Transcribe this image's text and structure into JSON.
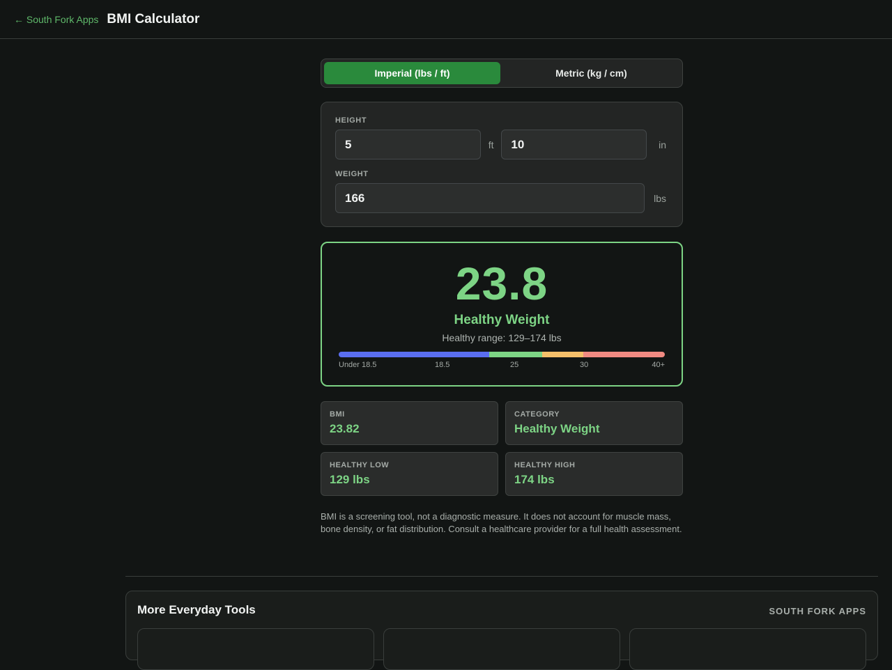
{
  "header": {
    "back_label": "← South Fork Apps",
    "title": "BMI Calculator"
  },
  "unit_toggle": {
    "options": [
      "Imperial (lbs / ft)",
      "Metric (kg / cm)"
    ],
    "selected": "Imperial (lbs / ft)"
  },
  "inputs": {
    "height_label": "HEIGHT",
    "height_ft": "5",
    "ft_unit": "ft",
    "height_in": "10",
    "in_unit": "in",
    "weight_label": "WEIGHT",
    "weight": "166",
    "weight_unit": "lbs"
  },
  "result": {
    "bmi": "23.8",
    "category": "Healthy Weight",
    "healthy_range": "Healthy range: 129–174 lbs",
    "marker_color": "#7dd485",
    "scale": {
      "segments": [
        {
          "color": "#5a6ef0",
          "from": 0,
          "to": 18.5
        },
        {
          "color": "#7dd485",
          "from": 18.5,
          "to": 25
        },
        {
          "color": "#f5c06a",
          "from": 25,
          "to": 30
        },
        {
          "color": "#f08a82",
          "from": 30,
          "to": 40
        }
      ],
      "labels": [
        "Under 18.5",
        "18.5",
        "25",
        "30",
        "40+"
      ]
    }
  },
  "stats": [
    {
      "label": "BMI",
      "value": "23.82"
    },
    {
      "label": "CATEGORY",
      "value": "Healthy Weight"
    },
    {
      "label": "HEALTHY LOW",
      "value": "129 lbs"
    },
    {
      "label": "HEALTHY HIGH",
      "value": "174 lbs"
    }
  ],
  "disclaimer": "BMI is a screening tool, not a diagnostic measure. It does not account for muscle mass, bone density, or fat distribution. Consult a healthcare provider for a full health assessment.",
  "footer": {
    "section_title": "More Everyday Tools",
    "brand": "SOUTH FORK APPS"
  },
  "colors": {
    "accent": "#7dd485",
    "primary_button": "#2a8a3c",
    "link": "#5fb86a",
    "background": "#121514"
  }
}
